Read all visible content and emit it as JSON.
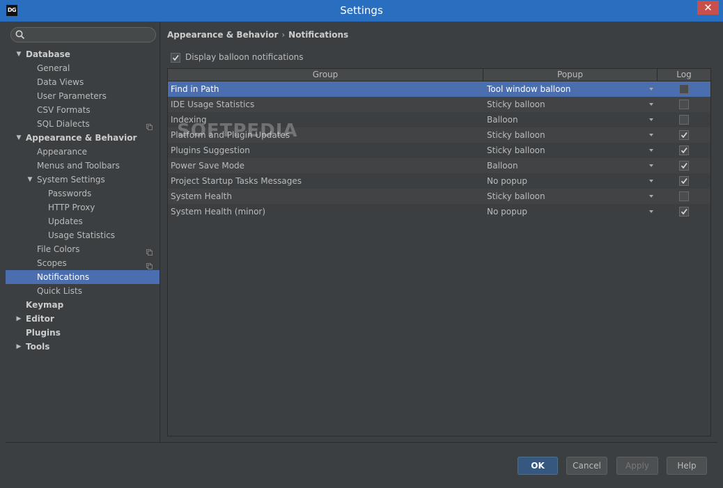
{
  "window": {
    "title": "Settings",
    "app_icon_text": "DG",
    "close_glyph": "✕"
  },
  "search": {
    "placeholder": "",
    "value": ""
  },
  "tree": [
    {
      "label": "Database",
      "level": 0,
      "bold": true,
      "arrow": "▼"
    },
    {
      "label": "General",
      "level": 1
    },
    {
      "label": "Data Views",
      "level": 1
    },
    {
      "label": "User Parameters",
      "level": 1
    },
    {
      "label": "CSV Formats",
      "level": 1
    },
    {
      "label": "SQL Dialects",
      "level": 1,
      "project_icon": true
    },
    {
      "label": "Appearance & Behavior",
      "level": 0,
      "bold": true,
      "arrow": "▼"
    },
    {
      "label": "Appearance",
      "level": 1
    },
    {
      "label": "Menus and Toolbars",
      "level": 1
    },
    {
      "label": "System Settings",
      "level": 1,
      "arrow": "▼"
    },
    {
      "label": "Passwords",
      "level": 2
    },
    {
      "label": "HTTP Proxy",
      "level": 2
    },
    {
      "label": "Updates",
      "level": 2
    },
    {
      "label": "Usage Statistics",
      "level": 2
    },
    {
      "label": "File Colors",
      "level": 1,
      "project_icon": true
    },
    {
      "label": "Scopes",
      "level": 1,
      "project_icon": true
    },
    {
      "label": "Notifications",
      "level": 1,
      "selected": true
    },
    {
      "label": "Quick Lists",
      "level": 1
    },
    {
      "label": "Keymap",
      "level": 0,
      "bold": true
    },
    {
      "label": "Editor",
      "level": 0,
      "bold": true,
      "arrow": "▶"
    },
    {
      "label": "Plugins",
      "level": 0,
      "bold": true
    },
    {
      "label": "Tools",
      "level": 0,
      "bold": true,
      "arrow": "▶"
    }
  ],
  "breadcrumb": {
    "parent": "Appearance & Behavior",
    "separator": "›",
    "current": "Notifications"
  },
  "display_balloon": {
    "label": "Display balloon notifications",
    "checked": true
  },
  "table": {
    "columns": [
      "Group",
      "Popup",
      "Log"
    ],
    "rows": [
      {
        "group": "Find in Path",
        "popup": "Tool window balloon",
        "log": false,
        "selected": true
      },
      {
        "group": "IDE Usage Statistics",
        "popup": "Sticky balloon",
        "log": false
      },
      {
        "group": "Indexing",
        "popup": "Balloon",
        "log": false
      },
      {
        "group": "Platform and Plugin Updates",
        "popup": "Sticky balloon",
        "log": true
      },
      {
        "group": "Plugins Suggestion",
        "popup": "Sticky balloon",
        "log": true
      },
      {
        "group": "Power Save Mode",
        "popup": "Balloon",
        "log": true
      },
      {
        "group": "Project Startup Tasks Messages",
        "popup": "No popup",
        "log": true
      },
      {
        "group": "System Health",
        "popup": "Sticky balloon",
        "log": false
      },
      {
        "group": "System Health (minor)",
        "popup": "No popup",
        "log": true
      }
    ]
  },
  "watermark": "SOFTPEDIA",
  "buttons": {
    "ok": "OK",
    "cancel": "Cancel",
    "apply": "Apply",
    "help": "Help"
  },
  "colors": {
    "selection": "#4b6eaf",
    "titlebar": "#2a6fbf",
    "close": "#c7504b",
    "primary_button": "#365880"
  }
}
